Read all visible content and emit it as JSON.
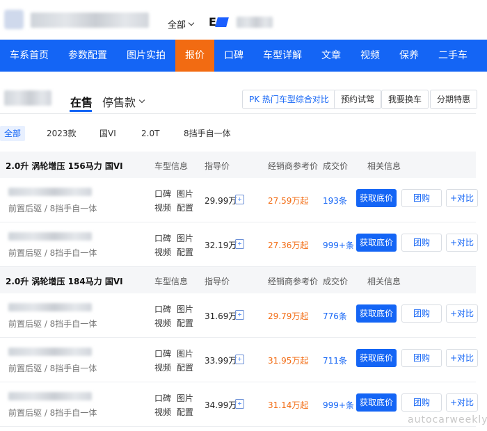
{
  "header": {
    "all_label": "全部",
    "brand_letter": "E"
  },
  "nav": {
    "items": [
      "车系首页",
      "参数配置",
      "图片实拍",
      "报价",
      "口碑",
      "车型详解",
      "文章",
      "视频",
      "保养",
      "二手车"
    ],
    "active": "报价"
  },
  "sub": {
    "tab_onsale": "在售",
    "tab_stopsale": "停售款",
    "buttons": [
      "PK 热门车型综合对比",
      "预约试驾",
      "我要换车",
      "分期特惠"
    ]
  },
  "filters": [
    "全部",
    "2023款",
    "国VI",
    "2.0T",
    "8挡手自一体"
  ],
  "columns": {
    "info": "车型信息",
    "guide": "指导价",
    "dealer": "经销商参考价",
    "deals": "成交价",
    "related": "相关信息"
  },
  "groups": [
    {
      "title": "2.0升 涡轮增压 156马力 国VI",
      "rows": [
        {
          "spec": "前置后驱 / 8挡手自一体",
          "guide": "29.99万",
          "dealer": "27.59万起",
          "deals": "193条"
        },
        {
          "spec": "前置后驱 / 8挡手自一体",
          "guide": "32.19万",
          "dealer": "27.36万起",
          "deals": "999+条"
        }
      ]
    },
    {
      "title": "2.0升 涡轮增压 184马力 国VI",
      "rows": [
        {
          "spec": "前置后驱 / 8挡手自一体",
          "guide": "31.69万",
          "dealer": "29.79万起",
          "deals": "776条"
        },
        {
          "spec": "前置后驱 / 8挡手自一体",
          "guide": "33.99万",
          "dealer": "31.95万起",
          "deals": "711条"
        },
        {
          "spec": "前置后驱 / 8挡手自一体",
          "guide": "34.99万",
          "dealer": "31.14万起",
          "deals": "999+条"
        }
      ]
    }
  ],
  "row_links": {
    "koubei": "口碑",
    "tupian": "图片",
    "shipin": "视频",
    "peizhi": "配置"
  },
  "row_buttons": {
    "lowest": "获取底价",
    "group": "团购",
    "compare": "+对比"
  },
  "calc_icon": "calculator-icon",
  "watermark": "autocarweekly",
  "colors": {
    "primary": "#1465f5",
    "accent": "#f26b12"
  }
}
